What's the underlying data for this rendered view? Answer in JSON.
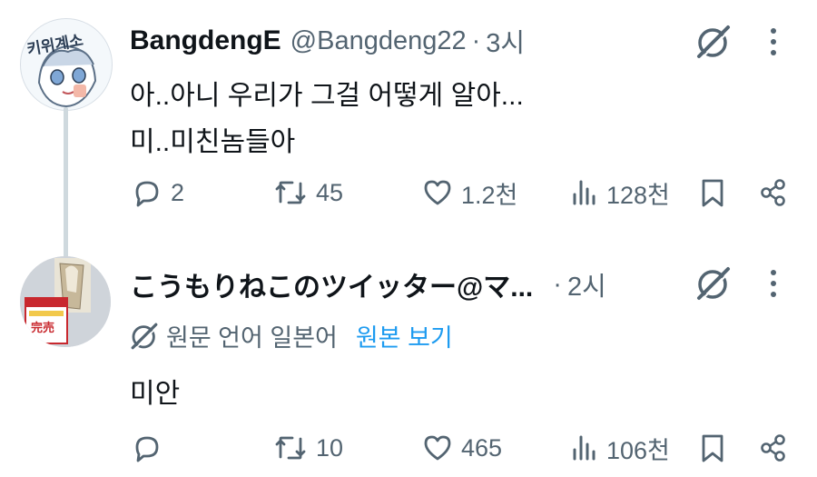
{
  "tweets": [
    {
      "author_name": "BangdengE",
      "handle": "@Bangdeng22",
      "separator": "·",
      "time": "3시",
      "lines": [
        "아..아니 우리가 그걸 어떻게 알아...",
        "미..미친놈들아"
      ],
      "actions": {
        "reply": "2",
        "retweet": "45",
        "like": "1.2천",
        "views": "128천"
      },
      "avatar_text": "키위계소"
    },
    {
      "author_name": "こうもりねこのツイッター@マ...",
      "separator": "·",
      "time": "2시",
      "translate_label": "원문 언어 일본어",
      "translate_link": "원본 보기",
      "lines": [
        "미안"
      ],
      "actions": {
        "reply": "",
        "retweet": "10",
        "like": "465",
        "views": "106천"
      },
      "avatar_text": "完売"
    }
  ],
  "colors": {
    "text": "#0f1419",
    "muted": "#536471",
    "link": "#1d9bf0",
    "thread": "#cfd9de"
  },
  "icons": [
    "grok-icon",
    "more-icon",
    "reply-icon",
    "retweet-icon",
    "like-icon",
    "views-icon",
    "bookmark-icon",
    "share-icon",
    "translate-icon"
  ]
}
